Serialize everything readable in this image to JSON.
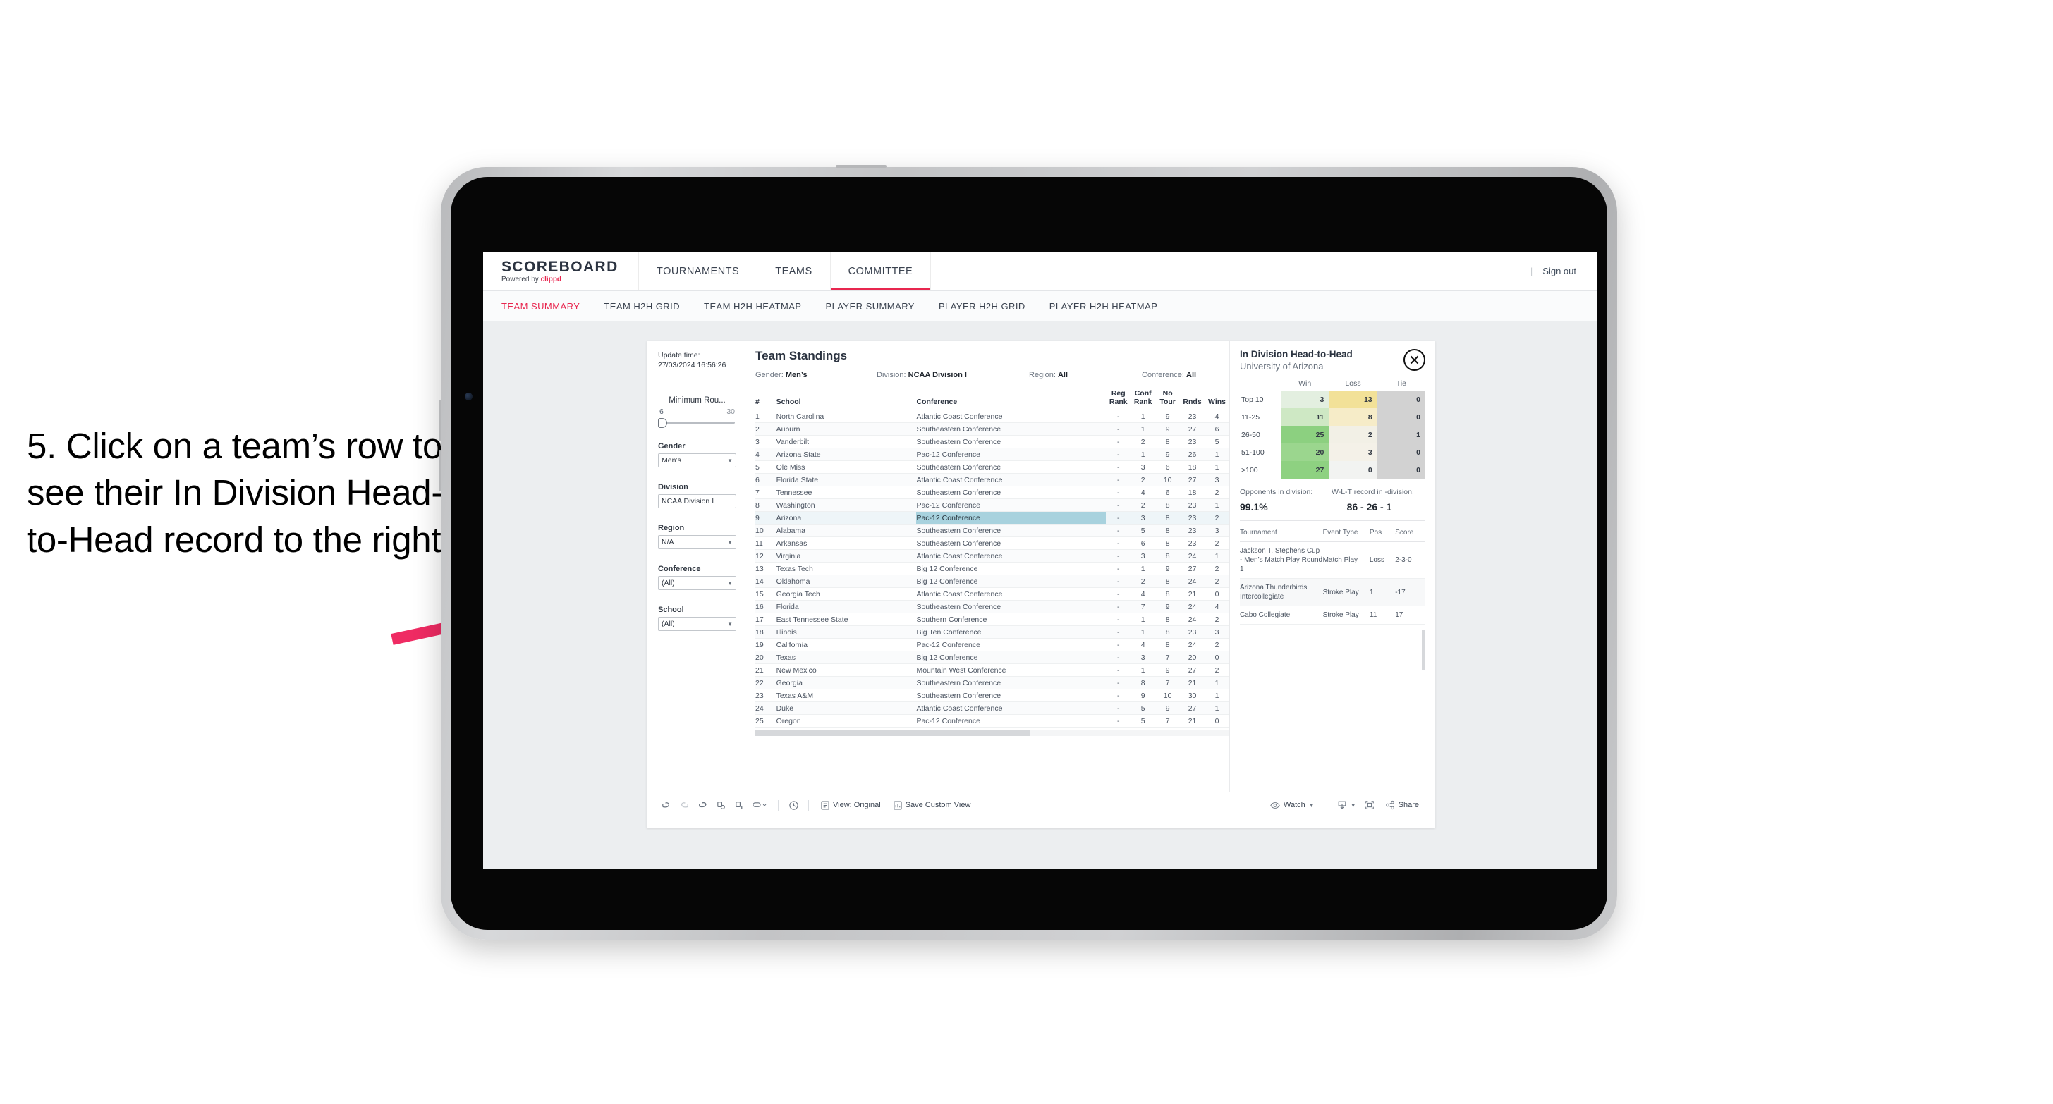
{
  "annotation": {
    "text": "5. Click on a team’s row to see their In Division Head-to-Head record to the right",
    "arrow_color": "#ef2b63"
  },
  "topnav": {
    "brand_main": "SCOREBOARD",
    "brand_sub_prefix": "Powered by ",
    "brand_sub_accent": "clippd",
    "items": [
      {
        "label": "TOURNAMENTS",
        "active": false
      },
      {
        "label": "TEAMS",
        "active": false
      },
      {
        "label": "COMMITTEE",
        "active": true
      }
    ],
    "divider": "|",
    "signout": "Sign out",
    "accent": "#e8264f"
  },
  "subtabs": [
    {
      "label": "TEAM SUMMARY",
      "active": true
    },
    {
      "label": "TEAM H2H GRID",
      "active": false
    },
    {
      "label": "TEAM H2H HEATMAP",
      "active": false
    },
    {
      "label": "PLAYER SUMMARY",
      "active": false
    },
    {
      "label": "PLAYER H2H GRID",
      "active": false
    },
    {
      "label": "PLAYER H2H HEATMAP",
      "active": false
    }
  ],
  "filters": {
    "update_label": "Update time:",
    "update_value": "27/03/2024 16:56:26",
    "min_rounds_label": "Minimum Rou...",
    "min_rounds_low": "6",
    "min_rounds_high": "30",
    "groups": [
      {
        "label": "Gender",
        "value": "Men’s"
      },
      {
        "label": "Division",
        "value": "NCAA Division I"
      },
      {
        "label": "Region",
        "value": "N/A"
      },
      {
        "label": "Conference",
        "value": "(All)"
      },
      {
        "label": "School",
        "value": "(All)"
      }
    ]
  },
  "standings": {
    "title": "Team Standings",
    "filter_summary": [
      {
        "label": "Gender:",
        "value": "Men’s"
      },
      {
        "label": "Division:",
        "value": "NCAA Division I"
      },
      {
        "label": "Region:",
        "value": "All"
      },
      {
        "label": "Conference:",
        "value": "All"
      }
    ],
    "columns": [
      "#",
      "School",
      "Conference",
      "Reg Rank",
      "Conf Rank",
      "No Tour",
      "Rnds",
      "Wins"
    ],
    "columns_wrapped": [
      {
        "l1": "#",
        "l2": ""
      },
      {
        "l1": "School",
        "l2": ""
      },
      {
        "l1": "Conference",
        "l2": ""
      },
      {
        "l1": "Reg",
        "l2": "Rank"
      },
      {
        "l1": "Conf",
        "l2": "Rank"
      },
      {
        "l1": "No",
        "l2": "Tour"
      },
      {
        "l1": "Rnds",
        "l2": ""
      },
      {
        "l1": "Wins",
        "l2": ""
      }
    ],
    "selected_row": 9,
    "rows": [
      {
        "n": "1",
        "school": "North Carolina",
        "conf": "Atlantic Coast Conference",
        "reg": "-",
        "crank": "1",
        "notour": "9",
        "rnds": "23",
        "wins": "4"
      },
      {
        "n": "2",
        "school": "Auburn",
        "conf": "Southeastern Conference",
        "reg": "-",
        "crank": "1",
        "notour": "9",
        "rnds": "27",
        "wins": "6"
      },
      {
        "n": "3",
        "school": "Vanderbilt",
        "conf": "Southeastern Conference",
        "reg": "-",
        "crank": "2",
        "notour": "8",
        "rnds": "23",
        "wins": "5"
      },
      {
        "n": "4",
        "school": "Arizona State",
        "conf": "Pac-12 Conference",
        "reg": "-",
        "crank": "1",
        "notour": "9",
        "rnds": "26",
        "wins": "1"
      },
      {
        "n": "5",
        "school": "Ole Miss",
        "conf": "Southeastern Conference",
        "reg": "-",
        "crank": "3",
        "notour": "6",
        "rnds": "18",
        "wins": "1"
      },
      {
        "n": "6",
        "school": "Florida State",
        "conf": "Atlantic Coast Conference",
        "reg": "-",
        "crank": "2",
        "notour": "10",
        "rnds": "27",
        "wins": "3"
      },
      {
        "n": "7",
        "school": "Tennessee",
        "conf": "Southeastern Conference",
        "reg": "-",
        "crank": "4",
        "notour": "6",
        "rnds": "18",
        "wins": "2"
      },
      {
        "n": "8",
        "school": "Washington",
        "conf": "Pac-12 Conference",
        "reg": "-",
        "crank": "2",
        "notour": "8",
        "rnds": "23",
        "wins": "1"
      },
      {
        "n": "9",
        "school": "Arizona",
        "conf": "Pac-12 Conference",
        "reg": "-",
        "crank": "3",
        "notour": "8",
        "rnds": "23",
        "wins": "2"
      },
      {
        "n": "10",
        "school": "Alabama",
        "conf": "Southeastern Conference",
        "reg": "-",
        "crank": "5",
        "notour": "8",
        "rnds": "23",
        "wins": "3"
      },
      {
        "n": "11",
        "school": "Arkansas",
        "conf": "Southeastern Conference",
        "reg": "-",
        "crank": "6",
        "notour": "8",
        "rnds": "23",
        "wins": "2"
      },
      {
        "n": "12",
        "school": "Virginia",
        "conf": "Atlantic Coast Conference",
        "reg": "-",
        "crank": "3",
        "notour": "8",
        "rnds": "24",
        "wins": "1"
      },
      {
        "n": "13",
        "school": "Texas Tech",
        "conf": "Big 12 Conference",
        "reg": "-",
        "crank": "1",
        "notour": "9",
        "rnds": "27",
        "wins": "2"
      },
      {
        "n": "14",
        "school": "Oklahoma",
        "conf": "Big 12 Conference",
        "reg": "-",
        "crank": "2",
        "notour": "8",
        "rnds": "24",
        "wins": "2"
      },
      {
        "n": "15",
        "school": "Georgia Tech",
        "conf": "Atlantic Coast Conference",
        "reg": "-",
        "crank": "4",
        "notour": "8",
        "rnds": "21",
        "wins": "0"
      },
      {
        "n": "16",
        "school": "Florida",
        "conf": "Southeastern Conference",
        "reg": "-",
        "crank": "7",
        "notour": "9",
        "rnds": "24",
        "wins": "4"
      },
      {
        "n": "17",
        "school": "East Tennessee State",
        "conf": "Southern Conference",
        "reg": "-",
        "crank": "1",
        "notour": "8",
        "rnds": "24",
        "wins": "2"
      },
      {
        "n": "18",
        "school": "Illinois",
        "conf": "Big Ten Conference",
        "reg": "-",
        "crank": "1",
        "notour": "8",
        "rnds": "23",
        "wins": "3"
      },
      {
        "n": "19",
        "school": "California",
        "conf": "Pac-12 Conference",
        "reg": "-",
        "crank": "4",
        "notour": "8",
        "rnds": "24",
        "wins": "2"
      },
      {
        "n": "20",
        "school": "Texas",
        "conf": "Big 12 Conference",
        "reg": "-",
        "crank": "3",
        "notour": "7",
        "rnds": "20",
        "wins": "0"
      },
      {
        "n": "21",
        "school": "New Mexico",
        "conf": "Mountain West Conference",
        "reg": "-",
        "crank": "1",
        "notour": "9",
        "rnds": "27",
        "wins": "2"
      },
      {
        "n": "22",
        "school": "Georgia",
        "conf": "Southeastern Conference",
        "reg": "-",
        "crank": "8",
        "notour": "7",
        "rnds": "21",
        "wins": "1"
      },
      {
        "n": "23",
        "school": "Texas A&M",
        "conf": "Southeastern Conference",
        "reg": "-",
        "crank": "9",
        "notour": "10",
        "rnds": "30",
        "wins": "1"
      },
      {
        "n": "24",
        "school": "Duke",
        "conf": "Atlantic Coast Conference",
        "reg": "-",
        "crank": "5",
        "notour": "9",
        "rnds": "27",
        "wins": "1"
      },
      {
        "n": "25",
        "school": "Oregon",
        "conf": "Pac-12 Conference",
        "reg": "-",
        "crank": "5",
        "notour": "7",
        "rnds": "21",
        "wins": "0"
      }
    ]
  },
  "h2h": {
    "title": "In Division Head-to-Head",
    "subtitle": "University of Arizona",
    "close_icon": "close-icon",
    "columns": [
      "",
      "Win",
      "Loss",
      "Tie"
    ],
    "rows": [
      {
        "label": "Top 10",
        "win": "3",
        "loss": "13",
        "tie": "0",
        "win_color": "#e3efe0",
        "loss_color": "#f2e198",
        "tie_color": "#d2d2d2"
      },
      {
        "label": "11-25",
        "win": "11",
        "loss": "8",
        "tie": "0",
        "win_color": "#cee8c4",
        "loss_color": "#f6ecc8",
        "tie_color": "#d2d2d2"
      },
      {
        "label": "26-50",
        "win": "25",
        "loss": "2",
        "tie": "1",
        "win_color": "#8cd080",
        "loss_color": "#f2f0e6",
        "tie_color": "#d2d2d2"
      },
      {
        "label": "51-100",
        "win": "20",
        "loss": "3",
        "tie": "0",
        "win_color": "#9bd68e",
        "loss_color": "#f4f1e8",
        "tie_color": "#d2d2d2"
      },
      {
        "label": ">100",
        "win": "27",
        "loss": "0",
        "tie": "0",
        "win_color": "#8ed181",
        "loss_color": "#f2f3f1",
        "tie_color": "#d2d2d2"
      }
    ],
    "stats": [
      {
        "label": "Opponents in division:",
        "value": "99.1%"
      },
      {
        "label": "W-L-T record in -division:",
        "value": "86 - 26 - 1"
      }
    ],
    "tournament_columns": [
      "Tournament",
      "Event Type",
      "Pos",
      "Score"
    ],
    "tournaments": [
      {
        "name": "Jackson T. Stephens Cup - Men’s Match Play Round 1",
        "type": "Match Play",
        "pos": "Loss",
        "score": "2-3-0"
      },
      {
        "name": "Arizona Thunderbirds Intercollegiate",
        "type": "Stroke Play",
        "pos": "1",
        "score": "-17"
      },
      {
        "name": "Cabo Collegiate",
        "type": "Stroke Play",
        "pos": "11",
        "score": "17"
      }
    ]
  },
  "toolbar": {
    "icons": [
      "undo-icon",
      "redo-icon",
      "revert-icon",
      "refresh-data-icon",
      "pause-updates-icon",
      "view-original-icon"
    ],
    "clock_icon": "clock-icon",
    "view_label": "View: Original",
    "save_label": "Save Custom View",
    "watch_label": "Watch",
    "download_icon": "download-icon",
    "fullscreen_icon": "fullscreen-icon",
    "share_label": "Share"
  }
}
